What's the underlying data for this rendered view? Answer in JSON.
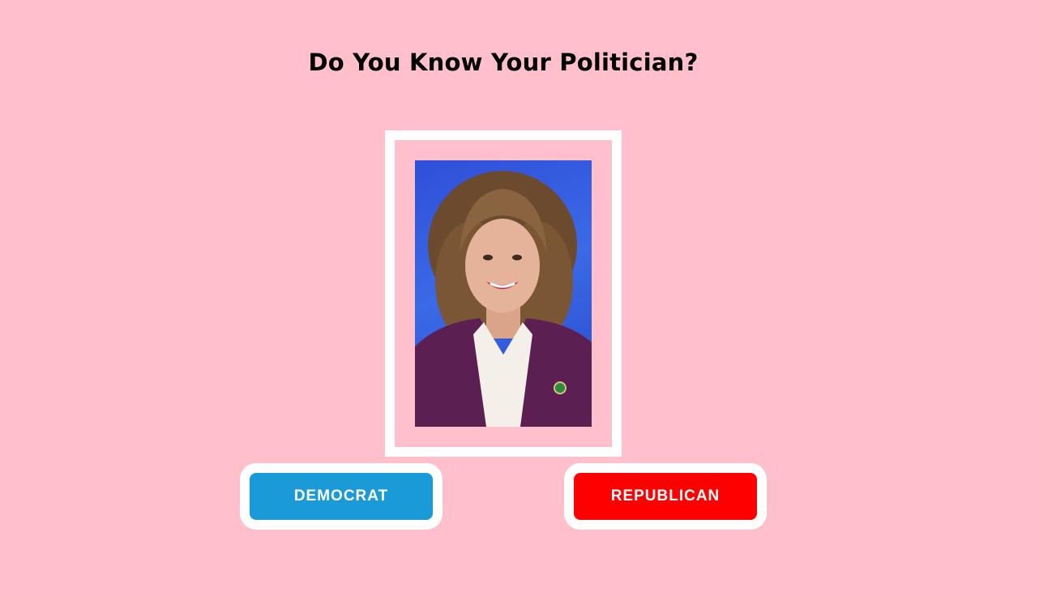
{
  "header": {
    "title": "Do You Know Your Politician?"
  },
  "photo": {
    "icon": "politician-portrait"
  },
  "buttons": {
    "democrat_label": "DEMOCRAT",
    "republican_label": "REPUBLICAN"
  },
  "colors": {
    "background": "#ffbfcb",
    "democrat": "#1a9ad6",
    "republican": "#ff0000",
    "frame": "#ffffff"
  }
}
